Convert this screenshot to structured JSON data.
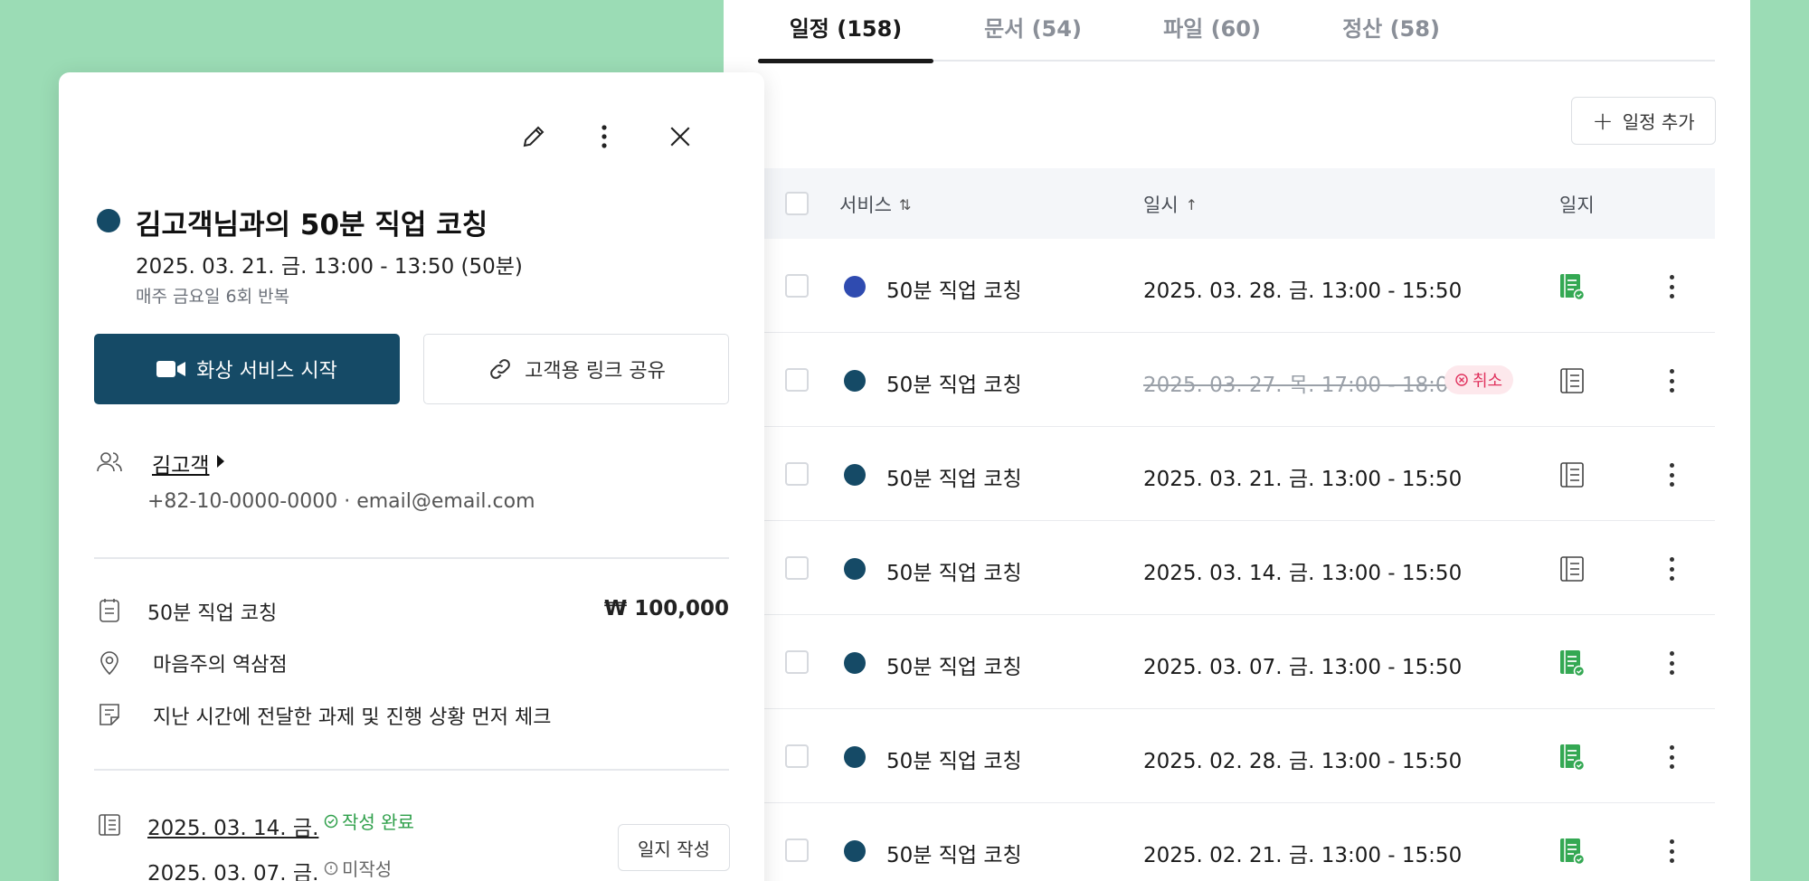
{
  "tabs": [
    {
      "label": "일정 (158)"
    },
    {
      "label": "문서 (54)"
    },
    {
      "label": "파일 (60)"
    },
    {
      "label": "정산 (58)"
    }
  ],
  "add_button_label": "일정 추가",
  "table": {
    "headers": {
      "service": "서비스",
      "datetime": "일시",
      "journal": "일지"
    },
    "rows": [
      {
        "service": "50분 직업 코칭",
        "datetime": "2025. 03. 28. 금. 13:00 - 15:50",
        "dot_color": "#2f4bb0",
        "journal": "done"
      },
      {
        "service": "50분 직업 코칭",
        "datetime": "2025. 03. 27. 목. 17:00 - 18:00",
        "dot_color": "#154a66",
        "journal": "empty",
        "cancelled": true,
        "badge": "취소"
      },
      {
        "service": "50분 직업 코칭",
        "datetime": "2025. 03. 21. 금. 13:00 - 15:50",
        "dot_color": "#154a66",
        "journal": "empty"
      },
      {
        "service": "50분 직업 코칭",
        "datetime": "2025. 03. 14. 금. 13:00 - 15:50",
        "dot_color": "#154a66",
        "journal": "empty"
      },
      {
        "service": "50분 직업 코칭",
        "datetime": "2025. 03. 07. 금. 13:00 - 15:50",
        "dot_color": "#154a66",
        "journal": "done"
      },
      {
        "service": "50분 직업 코칭",
        "datetime": "2025. 02. 28. 금. 13:00 - 15:50",
        "dot_color": "#154a66",
        "journal": "done"
      },
      {
        "service": "50분 직업 코칭",
        "datetime": "2025. 02. 21. 금. 13:00 - 15:50",
        "dot_color": "#154a66",
        "journal": "done"
      }
    ]
  },
  "detail": {
    "title": "김고객님과의 50분 직업 코칭",
    "datetime": "2025. 03. 21. 금. 13:00 - 13:50 (50분)",
    "repeat": "매주 금요일 6회 반복",
    "video_button": "화상 서비스 시작",
    "share_button": "고객용 링크 공유",
    "customer_name": "김고객",
    "contact": "+82-10-0000-0000 · email@email.com",
    "service": "50분 직업 코칭",
    "price": "₩ 100,000",
    "location": "마음주의 역삼점",
    "memo": "지난 시간에 전달한 과제 및 진행 상황 먼저 체크",
    "journals": [
      {
        "date": "2025. 03. 14. 금.",
        "status": "작성 완료"
      },
      {
        "date": "2025. 03. 07. 금.",
        "status": "미작성"
      }
    ],
    "write_button": "일지 작성"
  },
  "colors": {
    "background": "#9bdcb5",
    "primary": "#154a66",
    "success": "#2e9f4a",
    "danger": "#e0315d"
  }
}
